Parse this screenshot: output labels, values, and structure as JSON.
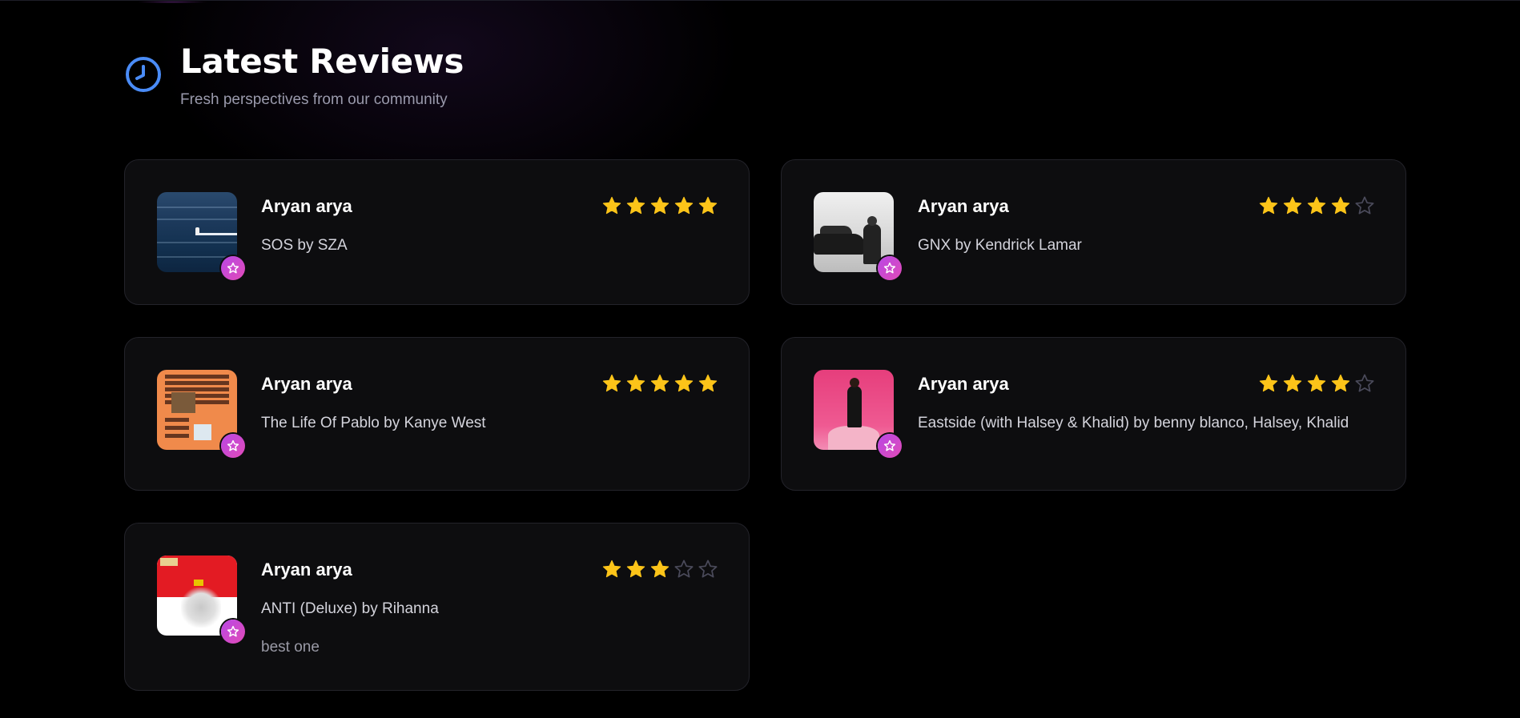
{
  "header": {
    "icon": "clock-icon",
    "title": "Latest Reviews",
    "subtitle": "Fresh perspectives from our community"
  },
  "colors": {
    "accent_blue": "#4a8cf7",
    "star_filled": "#fcc419",
    "star_empty": "#4a4a5a",
    "badge_gradient_start": "#b847e6",
    "badge_gradient_end": "#e14bb7",
    "card_bg": "#0d0d0f"
  },
  "reviews": [
    {
      "reviewer": "Aryan arya",
      "album": "SOS by SZA",
      "rating": 5,
      "comment": "",
      "badge_icon": "star-icon"
    },
    {
      "reviewer": "Aryan arya",
      "album": "GNX by Kendrick Lamar",
      "rating": 4,
      "comment": "",
      "badge_icon": "star-icon"
    },
    {
      "reviewer": "Aryan arya",
      "album": "The Life Of Pablo by Kanye West",
      "rating": 5,
      "comment": "",
      "badge_icon": "star-icon"
    },
    {
      "reviewer": "Aryan arya",
      "album": "Eastside (with Halsey & Khalid) by benny blanco, Halsey, Khalid",
      "rating": 4,
      "comment": "",
      "badge_icon": "star-icon"
    },
    {
      "reviewer": "Aryan arya",
      "album": "ANTI (Deluxe) by Rihanna",
      "rating": 3,
      "comment": "best one",
      "badge_icon": "star-icon"
    }
  ],
  "rating_max": 5
}
